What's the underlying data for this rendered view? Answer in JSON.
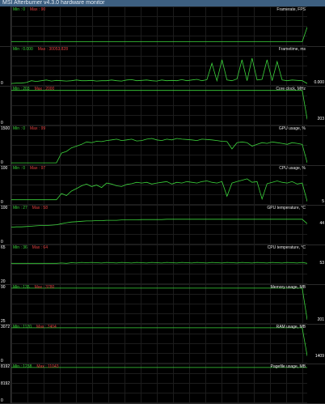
{
  "window": {
    "title": "MSI Afterburner v4.3.0 hardware monitor"
  },
  "colors": {
    "line": "#3cd43c",
    "min_text": "#3cd43c",
    "max_text": "#e24040",
    "grid": "#1c1c1c"
  },
  "panels": [
    {
      "title": "Framerate, FPS",
      "min_label": "Min : 0",
      "max_label": "Max : 90",
      "y_top": "",
      "y_bottom": "",
      "ymax": 90,
      "current": "",
      "series": [
        0.08,
        0.08,
        0.08,
        0.08,
        0.08,
        0.08,
        0.08,
        0.08,
        0.08,
        0.08,
        0.08,
        0.08,
        0.08,
        0.08,
        0.08,
        0.08,
        0.08,
        0.08,
        0.08,
        0.08,
        0.08,
        0.08,
        0.08,
        0.08,
        0.08,
        0.08,
        0.08,
        0.08,
        0.08,
        0.08,
        0.08,
        0.08,
        0.08,
        0.08,
        0.08,
        0.08,
        0.08,
        0.08,
        0.08,
        0.08,
        0.08,
        0.08,
        0.08,
        0.08,
        0.08,
        0.08,
        0.08,
        0.08,
        0.08,
        0.08,
        0.08,
        0.08,
        0.08,
        0.08,
        0.08,
        0.08,
        0.08,
        0.08,
        0.08,
        0.5
      ]
    },
    {
      "title": "Frametime, ms",
      "min_label": "Min : 0.000",
      "max_label": "Max : 30053.828",
      "y_top": "",
      "y_bottom": "0",
      "ymax": 100,
      "current": "0.000",
      "series": [
        0.02,
        0.03,
        0.03,
        0.05,
        0.1,
        0.08,
        0.1,
        0.12,
        0.09,
        0.11,
        0.1,
        0.09,
        0.1,
        0.12,
        0.1,
        0.1,
        0.11,
        0.09,
        0.1,
        0.1,
        0.12,
        0.1,
        0.09,
        0.12,
        0.13,
        0.1,
        0.11,
        0.12,
        0.1,
        0.09,
        0.12,
        0.1,
        0.11,
        0.1,
        0.13,
        0.1,
        0.12,
        0.14,
        0.1,
        0.13,
        0.6,
        0.1,
        0.7,
        0.12,
        0.1,
        0.15,
        0.7,
        0.1,
        0.75,
        0.12,
        0.14,
        0.7,
        0.1,
        0.65,
        0.12,
        0.1,
        0.12,
        0.11,
        0.1,
        0.02
      ]
    },
    {
      "title": "Core clock, MHz",
      "min_label": "Min : 203",
      "max_label": "Max : 2000",
      "y_top": "",
      "y_bottom": "0",
      "ymax": 1500,
      "current": "203",
      "series": [
        0.96,
        0.96,
        0.96,
        0.96,
        0.96,
        0.96,
        0.96,
        0.96,
        0.96,
        0.96,
        0.96,
        0.96,
        0.96,
        0.96,
        0.96,
        0.96,
        0.96,
        0.96,
        0.96,
        0.96,
        0.96,
        0.96,
        0.96,
        0.96,
        0.96,
        0.96,
        0.96,
        0.96,
        0.96,
        0.96,
        0.96,
        0.96,
        0.96,
        0.96,
        0.96,
        0.96,
        0.96,
        0.96,
        0.96,
        0.96,
        0.96,
        0.96,
        0.96,
        0.96,
        0.96,
        0.96,
        0.96,
        0.96,
        0.96,
        0.96,
        0.96,
        0.96,
        0.96,
        0.96,
        0.96,
        0.96,
        0.96,
        0.96,
        0.96,
        0.13
      ]
    },
    {
      "title": "GPU usage, %",
      "min_label": "Min : 0",
      "max_label": "Max : 99",
      "y_top": "1500",
      "y_bottom": "0",
      "ymax": 100,
      "current": "",
      "series": [
        0.02,
        0.02,
        0.02,
        0.02,
        0.02,
        0.02,
        0.02,
        0.02,
        0.02,
        0.02,
        0.3,
        0.35,
        0.45,
        0.5,
        0.55,
        0.62,
        0.6,
        0.64,
        0.63,
        0.66,
        0.68,
        0.7,
        0.66,
        0.68,
        0.7,
        0.65,
        0.66,
        0.7,
        0.72,
        0.68,
        0.66,
        0.7,
        0.68,
        0.72,
        0.7,
        0.69,
        0.68,
        0.66,
        0.7,
        0.69,
        0.68,
        0.66,
        0.64,
        0.63,
        0.42,
        0.6,
        0.62,
        0.6,
        0.5,
        0.55,
        0.6,
        0.58,
        0.62,
        0.6,
        0.58,
        0.55,
        0.6,
        0.58,
        0.55,
        0.02
      ]
    },
    {
      "title": "CPU usage, %",
      "min_label": "Min : 0",
      "max_label": "Max : 97",
      "y_top": "100",
      "y_bottom": "0",
      "ymax": 100,
      "current": "5",
      "series": [
        0.1,
        0.1,
        0.1,
        0.1,
        0.1,
        0.1,
        0.1,
        0.1,
        0.1,
        0.1,
        0.28,
        0.22,
        0.35,
        0.42,
        0.5,
        0.55,
        0.48,
        0.52,
        0.45,
        0.58,
        0.55,
        0.5,
        0.48,
        0.54,
        0.56,
        0.6,
        0.58,
        0.6,
        0.55,
        0.58,
        0.6,
        0.62,
        0.55,
        0.6,
        0.58,
        0.62,
        0.6,
        0.58,
        0.62,
        0.64,
        0.6,
        0.58,
        0.62,
        0.2,
        0.58,
        0.62,
        0.66,
        0.7,
        0.6,
        0.62,
        0.12,
        0.56,
        0.6,
        0.64,
        0.6,
        0.58,
        0.62,
        0.55,
        0.58,
        0.05
      ]
    },
    {
      "title": "GPU temperature, °C",
      "min_label": "Min : 27",
      "max_label": "Max : 58",
      "y_top": "100",
      "y_bottom": "0",
      "ymax": 100,
      "current": "44",
      "series": [
        0.45,
        0.46,
        0.46,
        0.47,
        0.48,
        0.49,
        0.5,
        0.5,
        0.51,
        0.52,
        0.55,
        0.58,
        0.6,
        0.61,
        0.62,
        0.63,
        0.63,
        0.64,
        0.64,
        0.65,
        0.65,
        0.65,
        0.66,
        0.66,
        0.66,
        0.66,
        0.67,
        0.67,
        0.67,
        0.67,
        0.67,
        0.68,
        0.68,
        0.68,
        0.68,
        0.68,
        0.68,
        0.68,
        0.68,
        0.68,
        0.68,
        0.68,
        0.68,
        0.68,
        0.68,
        0.68,
        0.68,
        0.68,
        0.68,
        0.68,
        0.68,
        0.68,
        0.68,
        0.68,
        0.68,
        0.68,
        0.68,
        0.68,
        0.68,
        0.55
      ]
    },
    {
      "title": "CPU temperature, °C",
      "min_label": "Min : 36",
      "max_label": "Max : 64",
      "y_top": "65",
      "y_bottom": "20",
      "ymax": 90,
      "current": "53",
      "series": [
        0.55,
        0.55,
        0.55,
        0.55,
        0.55,
        0.55,
        0.55,
        0.55,
        0.55,
        0.55,
        0.56,
        0.55,
        0.57,
        0.56,
        0.58,
        0.57,
        0.58,
        0.57,
        0.56,
        0.58,
        0.57,
        0.56,
        0.58,
        0.57,
        0.56,
        0.58,
        0.57,
        0.56,
        0.58,
        0.57,
        0.56,
        0.58,
        0.57,
        0.56,
        0.58,
        0.57,
        0.56,
        0.58,
        0.57,
        0.56,
        0.58,
        0.57,
        0.56,
        0.58,
        0.57,
        0.56,
        0.58,
        0.57,
        0.56,
        0.58,
        0.57,
        0.56,
        0.58,
        0.57,
        0.56,
        0.58,
        0.57,
        0.56,
        0.58,
        0.55
      ]
    },
    {
      "title": "Memory usage, MB",
      "min_label": "Min : 135",
      "max_label": "Max : 3780",
      "y_top": "90",
      "y_bottom": "25",
      "ymax": 3072,
      "current": "201",
      "series": [
        0.98,
        0.98,
        0.98,
        0.98,
        0.98,
        0.98,
        0.98,
        0.98,
        0.98,
        0.98,
        0.98,
        0.98,
        0.98,
        0.98,
        0.98,
        0.98,
        0.98,
        0.98,
        0.98,
        0.98,
        0.98,
        0.98,
        0.98,
        0.98,
        0.98,
        0.98,
        0.98,
        0.98,
        0.98,
        0.98,
        0.98,
        0.98,
        0.98,
        0.98,
        0.98,
        0.98,
        0.98,
        0.98,
        0.98,
        0.98,
        0.98,
        0.98,
        0.98,
        0.98,
        0.98,
        0.98,
        0.98,
        0.98,
        0.98,
        0.98,
        0.98,
        0.98,
        0.98,
        0.98,
        0.98,
        0.98,
        0.98,
        0.98,
        0.98,
        0.07
      ]
    },
    {
      "title": "RAM usage, MB",
      "min_label": "Min : 1120",
      "max_label": "Max : 7404",
      "y_top": "3072",
      "y_bottom": "0",
      "ymax": 8192,
      "current": "1409",
      "series": [
        0.98,
        0.98,
        0.98,
        0.98,
        0.98,
        0.98,
        0.98,
        0.98,
        0.98,
        0.98,
        0.98,
        0.98,
        0.98,
        0.98,
        0.98,
        0.98,
        0.98,
        0.98,
        0.98,
        0.98,
        0.98,
        0.98,
        0.98,
        0.98,
        0.98,
        0.98,
        0.98,
        0.98,
        0.98,
        0.98,
        0.98,
        0.98,
        0.98,
        0.98,
        0.98,
        0.98,
        0.98,
        0.98,
        0.98,
        0.98,
        0.98,
        0.98,
        0.98,
        0.98,
        0.98,
        0.98,
        0.98,
        0.98,
        0.98,
        0.98,
        0.98,
        0.98,
        0.98,
        0.98,
        0.98,
        0.98,
        0.98,
        0.98,
        0.98,
        0.17
      ]
    },
    {
      "title": "Pagefile usage, MB",
      "min_label": "Min : 1238",
      "max_label": "Max : 11043",
      "y_top": "8192",
      "y_bottom": "0",
      "ymax": 8192,
      "current": "",
      "series": [
        0.98,
        0.98,
        0.98,
        0.98,
        0.98,
        0.98,
        0.98,
        0.98,
        0.98,
        0.98,
        0.98,
        0.98,
        0.98,
        0.98,
        0.98,
        0.98,
        0.98,
        0.98,
        0.98,
        0.98,
        0.98,
        0.98,
        0.98,
        0.98,
        0.98,
        0.98,
        0.98,
        0.98,
        0.98,
        0.98,
        0.98,
        0.98,
        0.98,
        0.98,
        0.98,
        0.98,
        0.98,
        0.98,
        0.98,
        0.98,
        0.98,
        0.98,
        0.98,
        0.98,
        0.98,
        0.98,
        0.98,
        0.98,
        0.98,
        0.98,
        0.98,
        0.98,
        0.98,
        0.98,
        0.98,
        0.98,
        0.98,
        0.98,
        0.98,
        0.98
      ]
    }
  ],
  "footer_y_label": "8192"
}
